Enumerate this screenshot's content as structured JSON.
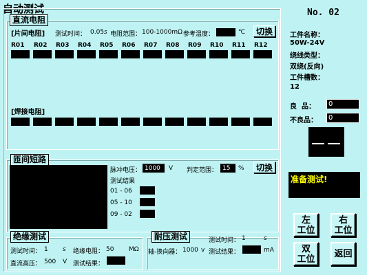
{
  "window": {
    "title": "自动测试"
  },
  "device_no": "No. 02",
  "dc_resistance": {
    "section_label": "直流电阻",
    "subsection_label": "[片间电阻]",
    "test_time_label": "测试时间：",
    "test_time_value": "0.05",
    "test_time_unit": "s",
    "range_label": "电阻范围：",
    "range_value": "100-1000mΩ",
    "ref_temp_label": "参考温度：",
    "ref_temp_value": "",
    "temp_unit": "℃",
    "switch_label": "切换",
    "channels": [
      "R01",
      "R02",
      "R03",
      "R04",
      "R05",
      "R06",
      "R07",
      "R08",
      "R09",
      "R10",
      "R11",
      "R12"
    ],
    "weld_label": "[焊接电阻]"
  },
  "inter_turn": {
    "section_label": "匝间短路",
    "pulse_voltage_label": "脉冲电压：",
    "pulse_voltage_value": "1000",
    "pulse_voltage_unit": "V",
    "judge_range_label": "判定范围：",
    "judge_range_value": "15",
    "judge_range_unit": "%",
    "switch_label": "切换",
    "result_label": "测试结果",
    "pairs": [
      "01 - 06",
      "05 - 10",
      "09 - 02"
    ]
  },
  "insulation": {
    "section_label": "绝缘测试",
    "test_time_label": "测试时间：",
    "test_time_value": "1",
    "test_time_unit": "s",
    "resistance_label": "绝缘电阻：",
    "resistance_value": "50",
    "resistance_unit": "MΩ",
    "dc_high_label": "直流高压：",
    "dc_high_value": "500",
    "dc_high_unit": "V",
    "result_label": "测试结果："
  },
  "withstand": {
    "section_label": "耐压测试",
    "test_time_label": "测试时间：",
    "test_time_value": "1",
    "test_time_unit": "s",
    "commutator_label": "轴-换向器：",
    "commutator_value": "1000",
    "commutator_unit": "v",
    "result_label": "测试结果：",
    "result_unit": "mA"
  },
  "workpiece": {
    "name_label": "工件名称：",
    "name_value": "50W-24V",
    "winding_type_label": "绕线类型：",
    "winding_type_value": "双绕(反向)",
    "slot_count_label": "工件槽数：",
    "slot_count_value": "12",
    "good_label": "良  品：",
    "good_value": "0",
    "bad_label": "不良品：",
    "bad_value": "0"
  },
  "status_message": "准备测试!",
  "buttons": {
    "left": "左\n工位",
    "right": "右\n工位",
    "double": "双\n工位",
    "back": "返回"
  },
  "colors": {
    "background": "#bff3f3",
    "status_text": "#ffff00",
    "field_bg": "#000000"
  }
}
